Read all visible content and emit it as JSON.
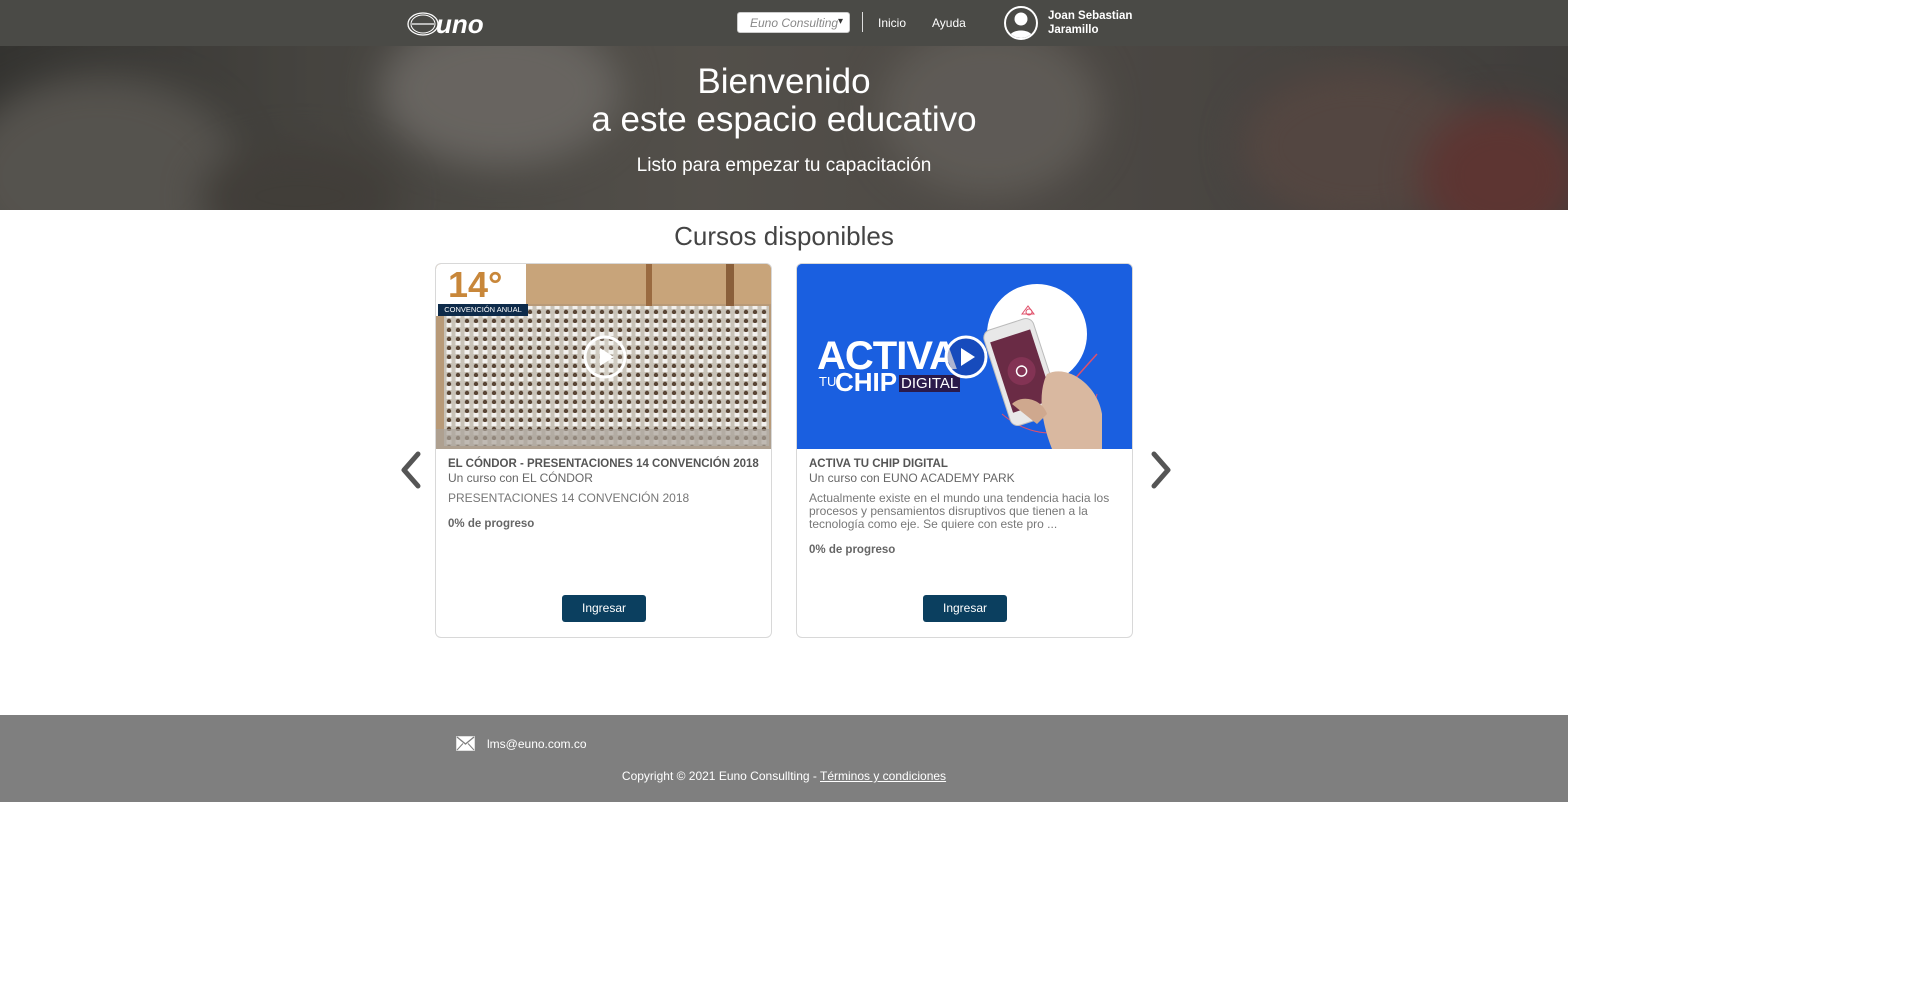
{
  "header": {
    "org_select_value": "Euno Consulting",
    "nav": {
      "inicio": "Inicio",
      "ayuda": "Ayuda"
    },
    "user_name": "Joan Sebastian Jaramillo"
  },
  "hero": {
    "title_line1": "Bienvenido",
    "title_line2": "a este espacio educativo",
    "subtitle": "Listo para empezar tu capacitación"
  },
  "courses": {
    "section_title": "Cursos disponibles",
    "items": [
      {
        "badge_number": "14°",
        "badge_caption": "CONVENCIÓN ANUAL",
        "title": "EL CÓNDOR - PRESENTACIONES 14 CONVENCIÓN 2018",
        "by": "Un curso con EL CÓNDOR",
        "description": "PRESENTACIONES 14 CONVENCIÓN 2018",
        "progress": "0% de progreso",
        "button": "Ingresar"
      },
      {
        "banner_line1": "ACTIVA",
        "banner_tu": "TU",
        "banner_chip": "CHIP",
        "banner_digital": "DIGITAL",
        "title": "ACTIVA TU CHIP DIGITAL",
        "by": "Un curso con EUNO ACADEMY PARK",
        "description": "Actualmente existe en el mundo una tendencia hacia los procesos y pensamientos disruptivos que tienen a la tecnología como eje. Se quiere con este pro ...",
        "progress": "0% de progreso",
        "button": "Ingresar"
      }
    ]
  },
  "footer": {
    "email": "lms@euno.com.co",
    "copyright": "Copyright © 2021 Euno Consullting - ",
    "terms_link": "Términos y condiciones"
  },
  "icons": [
    "euno-logo",
    "chevron-down-icon",
    "user-avatar-icon",
    "play-icon",
    "chevron-left-icon",
    "chevron-right-icon",
    "mail-icon"
  ],
  "colors": {
    "header_bg": "#4a4a46",
    "button_bg": "#0b3f5f",
    "footer_bg": "#7f7f7f",
    "banner_blue": "#1a5fe0"
  }
}
